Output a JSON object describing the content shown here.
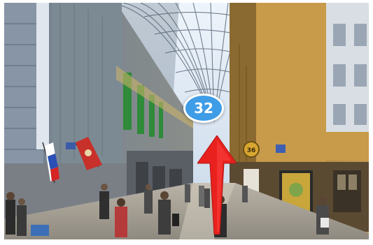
{
  "panorama": {
    "marker_label": "32",
    "marker_color": "#3f9ce6",
    "arrow_color": "#e8211f",
    "arrow_icon": "arrow-up-icon",
    "shop_sign_text": "36"
  }
}
